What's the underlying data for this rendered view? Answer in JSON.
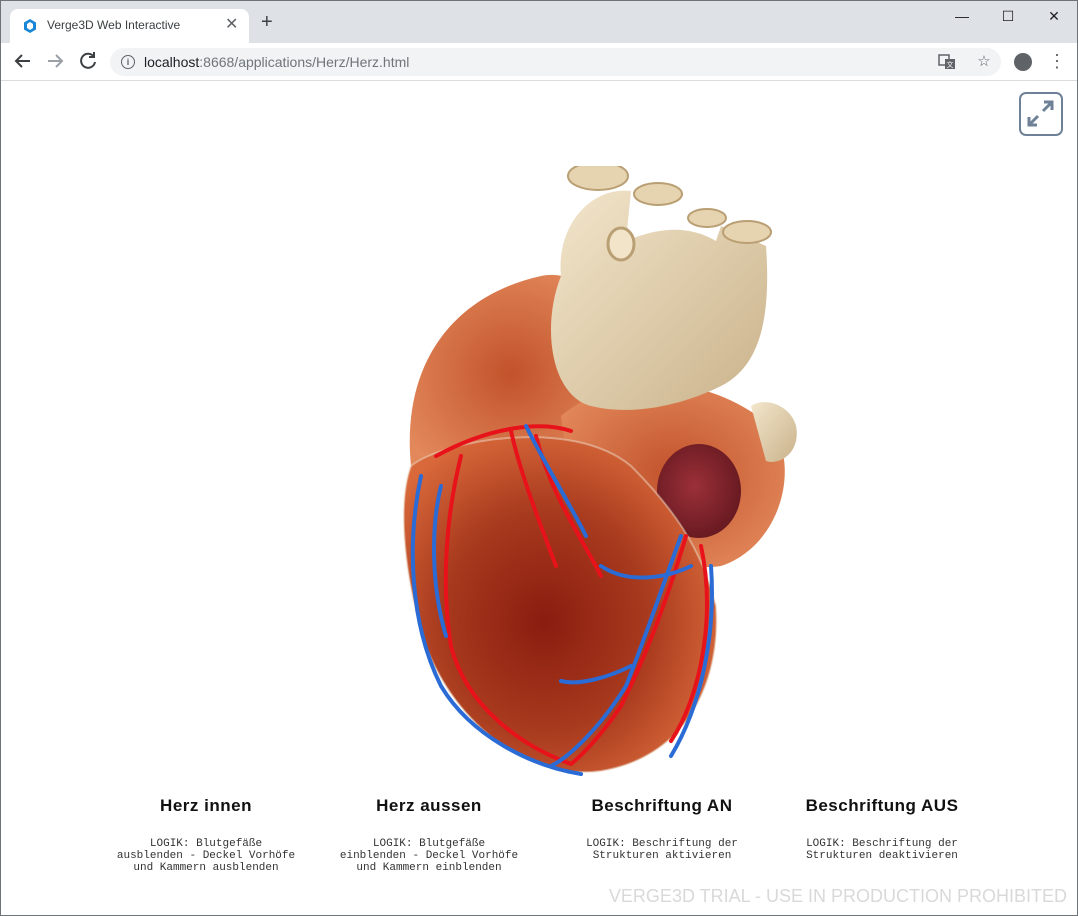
{
  "browser": {
    "tab_title": "Verge3D Web Interactive",
    "tab_close_glyph": "✕",
    "new_tab_glyph": "+",
    "url_host": "localhost",
    "url_rest": ":8668/applications/Herz/Herz.html",
    "icons": [
      "back-icon",
      "forward-icon",
      "reload-icon",
      "info-icon",
      "translate-icon",
      "bookmark-star-icon",
      "profile-icon",
      "menu-icon"
    ]
  },
  "window_controls": {
    "minimize": "—",
    "maximize": "☐",
    "close": "✕"
  },
  "app": {
    "controls": [
      {
        "title": "Herz innen",
        "desc": "LOGIK: Blutgefäße\nausblenden - Deckel Vorhöfe\nund Kammern ausblenden"
      },
      {
        "title": "Herz aussen",
        "desc": "LOGIK: Blutgefäße\neinblenden - Deckel Vorhöfe\nund Kammern einblenden"
      },
      {
        "title": "Beschriftung AN",
        "desc": "LOGIK: Beschriftung der\nStrukturen aktivieren"
      },
      {
        "title": "Beschriftung AUS",
        "desc": "LOGIK: Beschriftung der\nStrukturen deaktivieren"
      }
    ],
    "watermark": "VERGE3D TRIAL - USE IN PRODUCTION PROHIBITED"
  },
  "colors": {
    "vessel_red": "#e8121a",
    "vessel_blue": "#2a6bd6",
    "aorta": "#e9d8b7",
    "myocardium": "#b8401f",
    "fullscreen_icon": "#6f8196"
  }
}
